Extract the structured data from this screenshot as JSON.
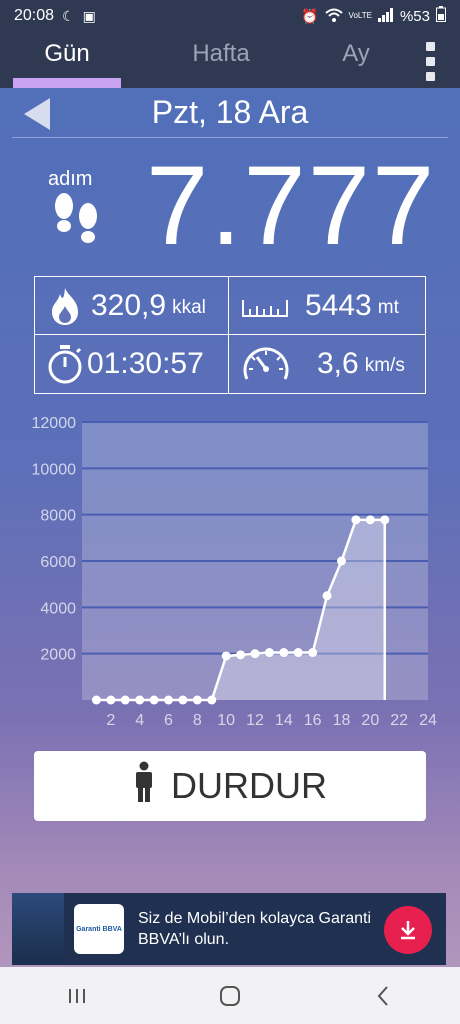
{
  "status_bar": {
    "time": "20:08",
    "battery": "%53",
    "network": "VoLTE"
  },
  "tabs": [
    {
      "label": "Gün",
      "active": true
    },
    {
      "label": "Hafta",
      "active": false
    },
    {
      "label": "Ay",
      "active": false
    }
  ],
  "date": "Pzt, 18 Ara",
  "steps": {
    "label": "adım",
    "value": "7.777"
  },
  "stats": {
    "calories": {
      "value": "320,9",
      "unit": "kkal",
      "icon": "flame-icon"
    },
    "distance": {
      "value": "5443",
      "unit": "mt",
      "icon": "ruler-icon"
    },
    "duration": {
      "value": "01:30:57",
      "icon": "stopwatch-icon"
    },
    "speed": {
      "value": "3,6",
      "unit": "km/s",
      "icon": "speedometer-icon"
    }
  },
  "chart_data": {
    "type": "area",
    "x": [
      1,
      2,
      3,
      4,
      5,
      6,
      7,
      8,
      9,
      10,
      11,
      12,
      13,
      14,
      15,
      16,
      17,
      18,
      19,
      20,
      21
    ],
    "values": [
      0,
      0,
      0,
      0,
      0,
      0,
      0,
      0,
      0,
      1900,
      1950,
      2000,
      2050,
      2050,
      2050,
      2050,
      4500,
      6000,
      7777,
      7777,
      7777
    ],
    "xticks": [
      2,
      4,
      6,
      8,
      10,
      12,
      14,
      16,
      18,
      20,
      22,
      24
    ],
    "yticks": [
      2000,
      4000,
      6000,
      8000,
      10000,
      12000
    ],
    "ylim": [
      0,
      12000
    ],
    "xlim": [
      0,
      24
    ]
  },
  "stop_button": {
    "label": "DURDUR"
  },
  "ad": {
    "logo_text": "Garanti BBVA",
    "text": "Siz de Mobil’den kolayca Garanti BBVA’lı olun."
  }
}
